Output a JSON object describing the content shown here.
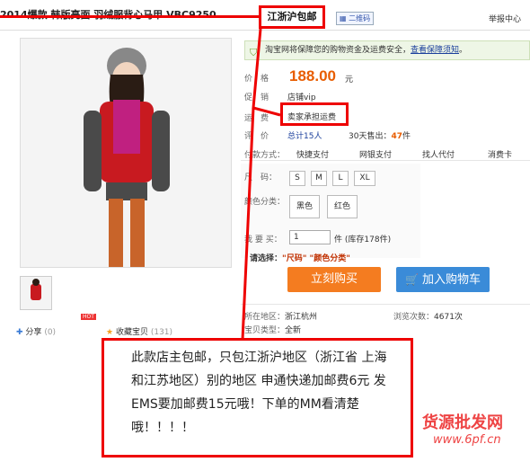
{
  "header": {
    "title_struck": "2014爆款 韩版亮面 羽绒服背心马甲 VBC9250",
    "title_highlight": "江浙沪包邮",
    "qr_label": "二维码",
    "report_label": "举报中心"
  },
  "guarantee": {
    "text": "淘宝网将保障您的购物资金及运费安全，",
    "link": "查看保障须知",
    "tail": "。"
  },
  "product": {
    "price_label": "价　格",
    "price": "188.00",
    "price_unit": "元",
    "promo_label": "促　销",
    "promo_value": "店铺vip",
    "shipping_label": "运　费",
    "shipping_value": "卖家承担运费",
    "rating_label": "评　价",
    "rating_value": "总计15人",
    "sold_30d_prefix": "30天售出：",
    "sold_30d": "47",
    "sold_30d_unit": "件"
  },
  "payment": {
    "label": "付款方式：",
    "options": [
      "快捷支付",
      "网银支付",
      "找人代付",
      "消费卡"
    ]
  },
  "options": {
    "size_label": "尺　码：",
    "sizes": [
      "S",
      "M",
      "L",
      "XL"
    ],
    "color_label": "颜色分类：",
    "colors": [
      "黑色",
      "红色"
    ],
    "qty_label": "我 要 买：",
    "qty_value": "1",
    "qty_unit": "件",
    "stock": "(库存178件)",
    "choose_prompt": "请选择：",
    "choose_items": "\"尺码\"  \"颜色分类\""
  },
  "actions": {
    "buy": "立刻购买",
    "cart": "加入购物车"
  },
  "meta": {
    "location_label": "所在地区：",
    "location": "浙江杭州",
    "views_label": "浏览次数：",
    "views": "4671次",
    "type_label": "宝贝类型：",
    "type": "全新"
  },
  "social": {
    "share": "分享",
    "share_count": "(0)",
    "hot_badge": "HOT",
    "fav": "收藏宝贝",
    "fav_count": "(131)"
  },
  "callout": {
    "text": "此款店主包邮，只包江浙沪地区（浙江省 上海和江苏地区）别的地区 申通快递加邮费6元 发EMS要加邮费15元哦！下单的MM看清楚哦！！！！"
  },
  "watermark": {
    "cn": "货源批发网",
    "url": "www.6pf.cn"
  },
  "colors": {
    "annotation_red": "#e00000",
    "price_orange": "#e85d00",
    "buy_orange": "#f47c20",
    "cart_blue": "#3a8bd8"
  }
}
